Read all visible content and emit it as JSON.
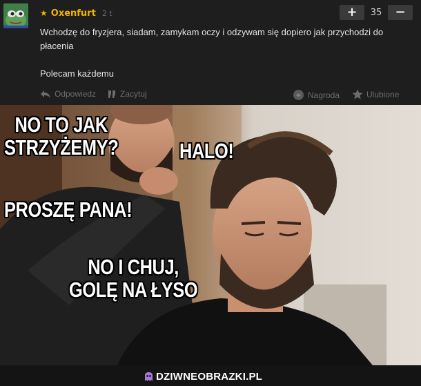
{
  "comment": {
    "author": "Oxenfurt",
    "age": "2 t",
    "score": "35",
    "upvote_label": "+",
    "downvote_label": "−",
    "paragraphs": [
      "Wchodzę do fryzjera, siadam, zamykam oczy i odzywam się dopiero jak przychodzi do płacenia",
      "Polecam każdemu"
    ],
    "actions": {
      "reply": "Odpowiedz",
      "quote": "Zacytuj",
      "award": "Nagroda",
      "favorite": "Ulubione"
    },
    "accent_color": "#f0b400"
  },
  "meme": {
    "captions": {
      "top_left": "NO TO JAK\nSTRZYŻEMY?",
      "top_right": "HALO!",
      "middle_left": "PROSZĘ PANA!",
      "bottom": "NO I CHUJ,\nGOLĘ NA ŁYSO"
    }
  },
  "footer": {
    "brand": "DZIWNEOBRAZKI.PL"
  }
}
